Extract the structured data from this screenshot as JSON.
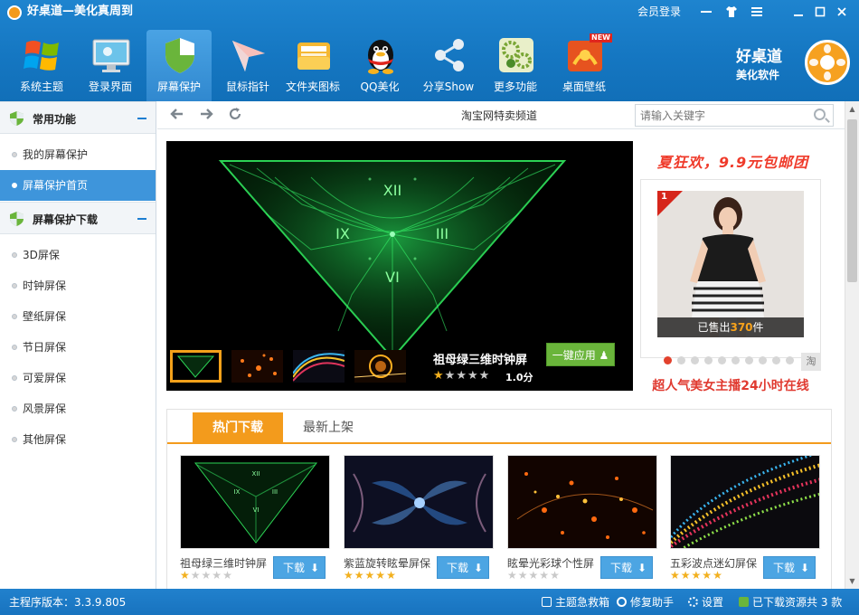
{
  "window": {
    "title": "好桌道—美化真周到",
    "login": "会员登录",
    "controls": [
      "minimize",
      "skin",
      "menu",
      "restore",
      "close"
    ]
  },
  "nav": {
    "items": [
      {
        "label": "系统主题",
        "icon": "windows-logo-icon"
      },
      {
        "label": "登录界面",
        "icon": "monitor-icon"
      },
      {
        "label": "屏幕保护",
        "icon": "shield-icon"
      },
      {
        "label": "鼠标指针",
        "icon": "paper-plane-icon"
      },
      {
        "label": "文件夹图标",
        "icon": "folder-icon"
      },
      {
        "label": "QQ美化",
        "icon": "qq-penguin-icon"
      },
      {
        "label": "分享Show",
        "icon": "share-icon"
      },
      {
        "label": "更多功能",
        "icon": "gears-icon"
      },
      {
        "label": "桌面壁纸",
        "icon": "wallpaper-icon",
        "badge": "NEW"
      }
    ],
    "active_index": 2
  },
  "brand": {
    "line1": "好桌道",
    "line2": "美化软件"
  },
  "sidebar": {
    "section1": {
      "title": "常用功能",
      "items": [
        "我的屏幕保护",
        "屏幕保护首页"
      ]
    },
    "section2": {
      "title": "屏幕保护下载",
      "items": [
        "3D屏保",
        "时钟屏保",
        "壁纸屏保",
        "节日屏保",
        "可爱屏保",
        "风景屏保",
        "其他屏保"
      ]
    },
    "active": "屏幕保护首页"
  },
  "toolbar": {
    "title": "淘宝网特卖频道",
    "search_placeholder": "请输入关键字"
  },
  "banner": {
    "name": "祖母绿三维时钟屏",
    "rating": 1,
    "score": "1.0分",
    "apply_label": "一键应用",
    "clock_numerals": [
      "XII",
      "IX",
      "III",
      "VI"
    ]
  },
  "promo": {
    "headline": "夏狂欢，9.9元包邮团",
    "rank": "1",
    "sold_prefix": "已售出",
    "sold_count": "370",
    "sold_suffix": "件",
    "taobao_mark": "淘",
    "footer": "超人气美女主播24小时在线",
    "dots_total": 10,
    "dots_active": 0
  },
  "tabs": {
    "items": [
      "热门下载",
      "最新上架"
    ],
    "active": 0
  },
  "cards": [
    {
      "name": "祖母绿三维时钟屏",
      "rating": 1,
      "download": "下载"
    },
    {
      "name": "紫蓝旋转眩晕屏保",
      "rating": 5,
      "download": "下载"
    },
    {
      "name": "眩晕光彩球个性屏",
      "rating": 0,
      "download": "下载"
    },
    {
      "name": "五彩波点迷幻屏保",
      "rating": 5,
      "download": "下载"
    }
  ],
  "status": {
    "version": "主程序版本：3.3.9.805",
    "emergency": "主题急救箱",
    "repair": "修复助手",
    "settings": "设置",
    "downloaded": "已下载资源共 3 款"
  },
  "colors": {
    "title_blue": "#1577c2",
    "accent_orange": "#f39b1c",
    "button_blue": "#4ca5e3",
    "apply_green": "#6ab53b",
    "star_gold": "#f2b01e",
    "promo_red": "#e03a30"
  }
}
